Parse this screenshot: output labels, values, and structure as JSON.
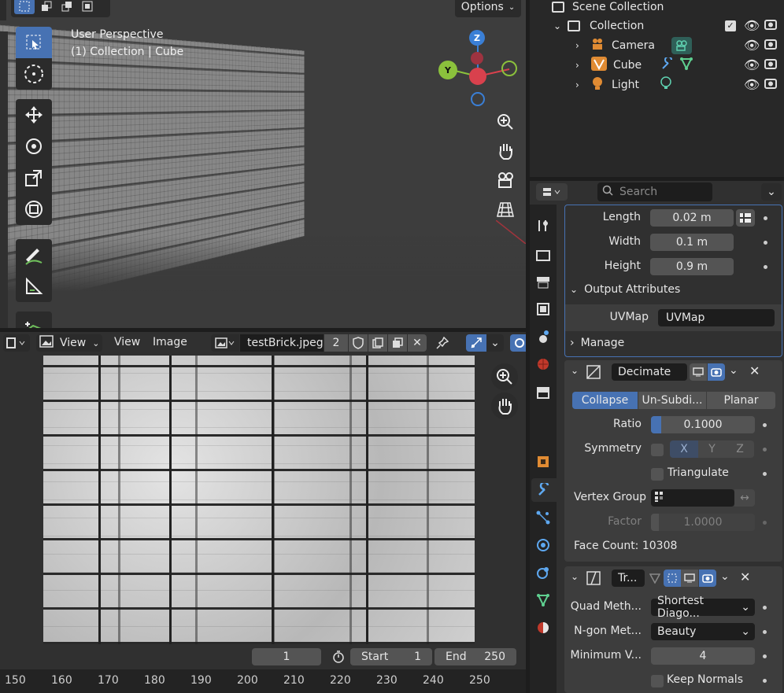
{
  "viewport": {
    "perspective": "User Perspective",
    "collection": "(1) Collection | Cube",
    "options_label": "Options",
    "gizmo": {
      "z": "Z",
      "y": "Y"
    }
  },
  "outliner": {
    "scene_collection": "Scene Collection",
    "collection": "Collection",
    "items": [
      {
        "label": "Camera",
        "icon": "camera-icon"
      },
      {
        "label": "Cube",
        "icon": "mesh-icon"
      },
      {
        "label": "Light",
        "icon": "light-icon"
      }
    ]
  },
  "properties": {
    "search_placeholder": "Search",
    "length_label": "Length",
    "length_value": "0.02 m",
    "width_label": "Width",
    "width_value": "0.1 m",
    "height_label": "Height",
    "height_value": "0.9 m",
    "output_attributes": "Output Attributes",
    "uvmap_label": "UVMap",
    "uvmap_value": "UVMap",
    "manage": "Manage",
    "decimate": {
      "name": "Decimate",
      "tabs": [
        "Collapse",
        "Un-Subdi...",
        "Planar"
      ],
      "ratio_label": "Ratio",
      "ratio_value": "0.1000",
      "ratio_fill": 0.1,
      "symmetry_label": "Symmetry",
      "axes": [
        "X",
        "Y",
        "Z"
      ],
      "triangulate": "Triangulate",
      "vertex_group_label": "Vertex Group",
      "factor_label": "Factor",
      "factor_value": "1.0000",
      "face_count": "Face Count: 10308"
    },
    "triangulate_mod": {
      "name": "Tr...",
      "quad_label": "Quad Meth...",
      "quad_value": "Shortest Diago...",
      "ngon_label": "N-gon Met...",
      "ngon_value": "Beauty",
      "minv_label": "Minimum V...",
      "minv_value": "4",
      "keep_normals": "Keep Normals"
    }
  },
  "image_editor": {
    "view_menu": "View",
    "menus": [
      "View",
      "Image"
    ],
    "image_name": "testBrick.jpeg",
    "users": "2"
  },
  "timeline": {
    "current_frame": "1",
    "start_label": "Start",
    "start_value": "1",
    "end_label": "End",
    "end_value": "250",
    "ticks": [
      "150",
      "160",
      "170",
      "180",
      "190",
      "200",
      "210",
      "220",
      "230",
      "240",
      "250"
    ]
  },
  "colors": {
    "accent": "#4772b3",
    "x_axis": "#d9414d",
    "y_axis": "#8bc13c",
    "z_axis": "#3a7fd6"
  }
}
